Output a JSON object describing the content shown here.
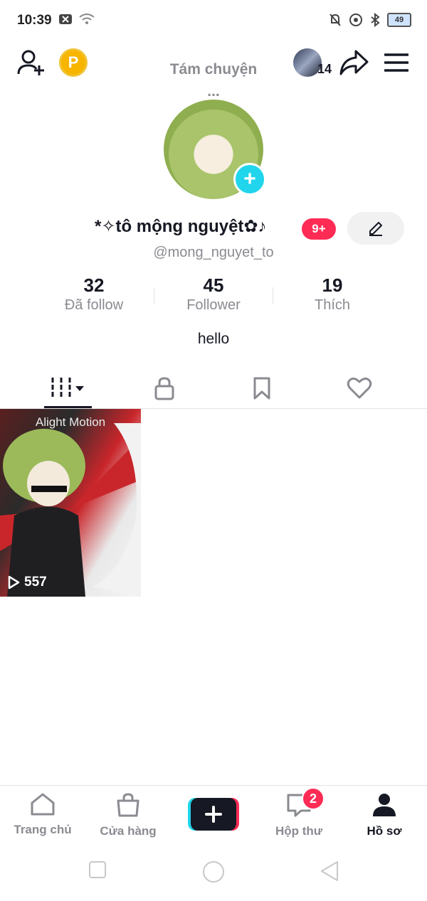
{
  "status_bar": {
    "time": "10:39",
    "battery": "49",
    "icons_left": [
      "notification-x-icon",
      "wifi-icon"
    ],
    "icons_right": [
      "mute-bell-icon",
      "location-icon",
      "bluetooth-icon",
      "battery-icon"
    ]
  },
  "header": {
    "title": "Tám chuyện ...",
    "coin_label": "P",
    "visitor_count": "14"
  },
  "profile": {
    "display_name": "*✧tô mộng nguyệt✿♪",
    "badge": "9+",
    "username": "@mong_nguyet_to",
    "bio": "hello",
    "stats": [
      {
        "value": "32",
        "label": "Đã follow"
      },
      {
        "value": "45",
        "label": "Follower"
      },
      {
        "value": "19",
        "label": "Thích"
      }
    ]
  },
  "tabs": [
    "videos-grid-icon",
    "lock-icon",
    "bookmark-icon",
    "heart-icon"
  ],
  "videos": [
    {
      "watermark": "Alight Motion",
      "views": "557"
    }
  ],
  "bottom_nav": {
    "items": [
      {
        "label": "Trang chủ",
        "icon": "home-icon"
      },
      {
        "label": "Cửa hàng",
        "icon": "shopping-bag-icon"
      },
      {
        "label": "",
        "icon": "create-plus-icon"
      },
      {
        "label": "Hộp thư",
        "icon": "inbox-icon",
        "badge": "2"
      },
      {
        "label": "Hồ sơ",
        "icon": "profile-icon",
        "active": true
      }
    ]
  },
  "colors": {
    "accent_red": "#fe2c55",
    "accent_cyan": "#20d5ec",
    "text_gray": "#8a8b91"
  }
}
